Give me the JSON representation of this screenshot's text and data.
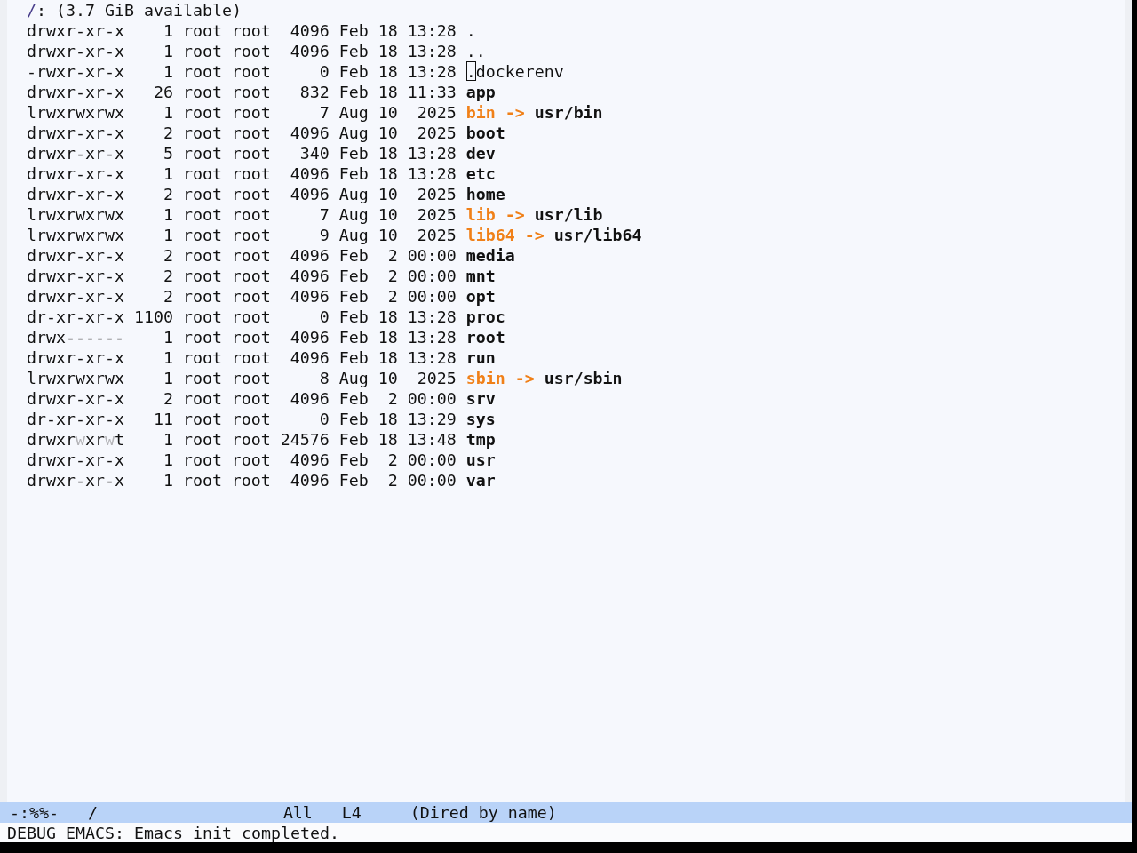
{
  "header": {
    "path": "/",
    "text": ": (3.7 GiB available)"
  },
  "rows": [
    {
      "permissions": [
        {
          "text": "drwxr-xr-x",
          "dimmed": false
        }
      ],
      "links": "1",
      "owner": "root",
      "group": "root",
      "size": "4096",
      "month": "Feb",
      "day": "18",
      "time": "13:28",
      "kind": "plain",
      "name": ".",
      "cursor": false
    },
    {
      "permissions": [
        {
          "text": "drwxr-xr-x",
          "dimmed": false
        }
      ],
      "links": "1",
      "owner": "root",
      "group": "root",
      "size": "4096",
      "month": "Feb",
      "day": "18",
      "time": "13:28",
      "kind": "plain",
      "name": "..",
      "cursor": false
    },
    {
      "permissions": [
        {
          "text": "-rwxr-xr-x",
          "dimmed": false
        }
      ],
      "links": "1",
      "owner": "root",
      "group": "root",
      "size": "0",
      "month": "Feb",
      "day": "18",
      "time": "13:28",
      "kind": "plain",
      "name": ".dockerenv",
      "cursor": true
    },
    {
      "permissions": [
        {
          "text": "drwxr-xr-x",
          "dimmed": false
        }
      ],
      "links": "26",
      "owner": "root",
      "group": "root",
      "size": "832",
      "month": "Feb",
      "day": "18",
      "time": "11:33",
      "kind": "directory",
      "name": "app",
      "cursor": false
    },
    {
      "permissions": [
        {
          "text": "lrwxrwxrwx",
          "dimmed": false
        }
      ],
      "links": "1",
      "owner": "root",
      "group": "root",
      "size": "7",
      "month": "Aug",
      "day": "10",
      "time": "2025",
      "kind": "symlink",
      "name": "bin",
      "arrow": "->",
      "target": "usr/bin",
      "cursor": false
    },
    {
      "permissions": [
        {
          "text": "drwxr-xr-x",
          "dimmed": false
        }
      ],
      "links": "2",
      "owner": "root",
      "group": "root",
      "size": "4096",
      "month": "Aug",
      "day": "10",
      "time": "2025",
      "kind": "directory",
      "name": "boot",
      "cursor": false
    },
    {
      "permissions": [
        {
          "text": "drwxr-xr-x",
          "dimmed": false
        }
      ],
      "links": "5",
      "owner": "root",
      "group": "root",
      "size": "340",
      "month": "Feb",
      "day": "18",
      "time": "13:28",
      "kind": "directory",
      "name": "dev",
      "cursor": false
    },
    {
      "permissions": [
        {
          "text": "drwxr-xr-x",
          "dimmed": false
        }
      ],
      "links": "1",
      "owner": "root",
      "group": "root",
      "size": "4096",
      "month": "Feb",
      "day": "18",
      "time": "13:28",
      "kind": "directory",
      "name": "etc",
      "cursor": false
    },
    {
      "permissions": [
        {
          "text": "drwxr-xr-x",
          "dimmed": false
        }
      ],
      "links": "2",
      "owner": "root",
      "group": "root",
      "size": "4096",
      "month": "Aug",
      "day": "10",
      "time": "2025",
      "kind": "directory",
      "name": "home",
      "cursor": false
    },
    {
      "permissions": [
        {
          "text": "lrwxrwxrwx",
          "dimmed": false
        }
      ],
      "links": "1",
      "owner": "root",
      "group": "root",
      "size": "7",
      "month": "Aug",
      "day": "10",
      "time": "2025",
      "kind": "symlink",
      "name": "lib",
      "arrow": "->",
      "target": "usr/lib",
      "cursor": false
    },
    {
      "permissions": [
        {
          "text": "lrwxrwxrwx",
          "dimmed": false
        }
      ],
      "links": "1",
      "owner": "root",
      "group": "root",
      "size": "9",
      "month": "Aug",
      "day": "10",
      "time": "2025",
      "kind": "symlink",
      "name": "lib64",
      "arrow": "->",
      "target": "usr/lib64",
      "cursor": false
    },
    {
      "permissions": [
        {
          "text": "drwxr-xr-x",
          "dimmed": false
        }
      ],
      "links": "2",
      "owner": "root",
      "group": "root",
      "size": "4096",
      "month": "Feb",
      "day": "2",
      "time": "00:00",
      "kind": "directory",
      "name": "media",
      "cursor": false
    },
    {
      "permissions": [
        {
          "text": "drwxr-xr-x",
          "dimmed": false
        }
      ],
      "links": "2",
      "owner": "root",
      "group": "root",
      "size": "4096",
      "month": "Feb",
      "day": "2",
      "time": "00:00",
      "kind": "directory",
      "name": "mnt",
      "cursor": false
    },
    {
      "permissions": [
        {
          "text": "drwxr-xr-x",
          "dimmed": false
        }
      ],
      "links": "2",
      "owner": "root",
      "group": "root",
      "size": "4096",
      "month": "Feb",
      "day": "2",
      "time": "00:00",
      "kind": "directory",
      "name": "opt",
      "cursor": false
    },
    {
      "permissions": [
        {
          "text": "dr-xr-xr-x",
          "dimmed": false
        }
      ],
      "links": "1100",
      "owner": "root",
      "group": "root",
      "size": "0",
      "month": "Feb",
      "day": "18",
      "time": "13:28",
      "kind": "directory",
      "name": "proc",
      "cursor": false
    },
    {
      "permissions": [
        {
          "text": "drwx------",
          "dimmed": false
        }
      ],
      "links": "1",
      "owner": "root",
      "group": "root",
      "size": "4096",
      "month": "Feb",
      "day": "18",
      "time": "13:28",
      "kind": "directory",
      "name": "root",
      "cursor": false
    },
    {
      "permissions": [
        {
          "text": "drwxr-xr-x",
          "dimmed": false
        }
      ],
      "links": "1",
      "owner": "root",
      "group": "root",
      "size": "4096",
      "month": "Feb",
      "day": "18",
      "time": "13:28",
      "kind": "directory",
      "name": "run",
      "cursor": false
    },
    {
      "permissions": [
        {
          "text": "lrwxrwxrwx",
          "dimmed": false
        }
      ],
      "links": "1",
      "owner": "root",
      "group": "root",
      "size": "8",
      "month": "Aug",
      "day": "10",
      "time": "2025",
      "kind": "symlink",
      "name": "sbin",
      "arrow": "->",
      "target": "usr/sbin",
      "cursor": false
    },
    {
      "permissions": [
        {
          "text": "drwxr-xr-x",
          "dimmed": false
        }
      ],
      "links": "2",
      "owner": "root",
      "group": "root",
      "size": "4096",
      "month": "Feb",
      "day": "2",
      "time": "00:00",
      "kind": "directory",
      "name": "srv",
      "cursor": false
    },
    {
      "permissions": [
        {
          "text": "dr-xr-xr-x",
          "dimmed": false
        }
      ],
      "links": "11",
      "owner": "root",
      "group": "root",
      "size": "0",
      "month": "Feb",
      "day": "18",
      "time": "13:29",
      "kind": "directory",
      "name": "sys",
      "cursor": false
    },
    {
      "permissions": [
        {
          "text": "drwxr",
          "dimmed": false
        },
        {
          "text": "w",
          "dimmed": true
        },
        {
          "text": "xr",
          "dimmed": false
        },
        {
          "text": "w",
          "dimmed": true
        },
        {
          "text": "t",
          "dimmed": false
        }
      ],
      "links": "1",
      "owner": "root",
      "group": "root",
      "size": "24576",
      "month": "Feb",
      "day": "18",
      "time": "13:48",
      "kind": "directory",
      "name": "tmp",
      "cursor": false
    },
    {
      "permissions": [
        {
          "text": "drwxr-xr-x",
          "dimmed": false
        }
      ],
      "links": "1",
      "owner": "root",
      "group": "root",
      "size": "4096",
      "month": "Feb",
      "day": "2",
      "time": "00:00",
      "kind": "directory",
      "name": "usr",
      "cursor": false
    },
    {
      "permissions": [
        {
          "text": "drwxr-xr-x",
          "dimmed": false
        }
      ],
      "links": "1",
      "owner": "root",
      "group": "root",
      "size": "4096",
      "month": "Feb",
      "day": "2",
      "time": "00:00",
      "kind": "directory",
      "name": "var",
      "cursor": false
    }
  ],
  "mode_line": {
    "status": "-:%%-",
    "buffer": "/",
    "position": "All",
    "line": "L4",
    "mode": "(Dired by name)"
  },
  "echo_area": "DEBUG EMACS: Emacs init completed."
}
